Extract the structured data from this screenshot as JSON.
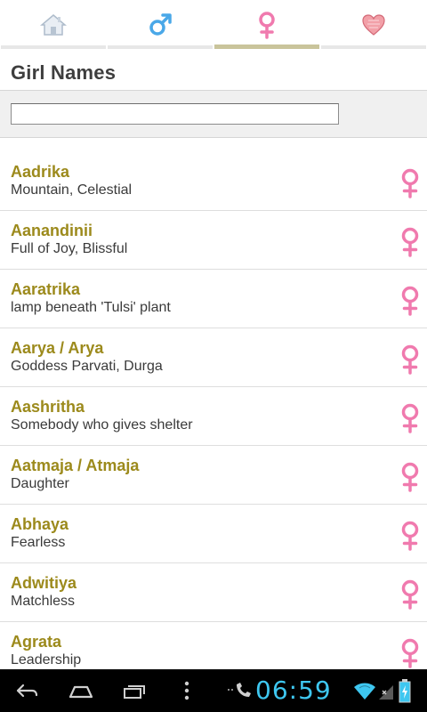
{
  "tabs": [
    {
      "name": "home",
      "icon": "home-icon",
      "active": false
    },
    {
      "name": "boy-names",
      "icon": "male-symbol-icon",
      "active": false
    },
    {
      "name": "girl-names",
      "icon": "female-symbol-icon",
      "active": true
    },
    {
      "name": "favorites",
      "icon": "heart-icon",
      "active": false
    }
  ],
  "page": {
    "title": "Girl Names"
  },
  "search": {
    "value": "",
    "placeholder": ""
  },
  "colors": {
    "name_text": "#9c8a1c",
    "female_icon": "#f07aae",
    "male_icon": "#4aa8e8",
    "active_tab": "#c9c49b",
    "clock": "#3ec7f0"
  },
  "names": [
    {
      "name": "Aadrika",
      "meaning": "Mountain, Celestial"
    },
    {
      "name": "Aanandinii",
      "meaning": "Full of Joy, Blissful"
    },
    {
      "name": "Aaratrika",
      "meaning": "lamp beneath 'Tulsi' plant"
    },
    {
      "name": "Aarya / Arya",
      "meaning": "Goddess Parvati, Durga"
    },
    {
      "name": "Aashritha",
      "meaning": "Somebody who gives shelter"
    },
    {
      "name": "Aatmaja / Atmaja",
      "meaning": "Daughter"
    },
    {
      "name": "Abhaya",
      "meaning": "Fearless"
    },
    {
      "name": "Adwitiya",
      "meaning": "Matchless"
    },
    {
      "name": "Agrata",
      "meaning": "Leadership"
    }
  ],
  "status_bar": {
    "time": "06:59"
  }
}
